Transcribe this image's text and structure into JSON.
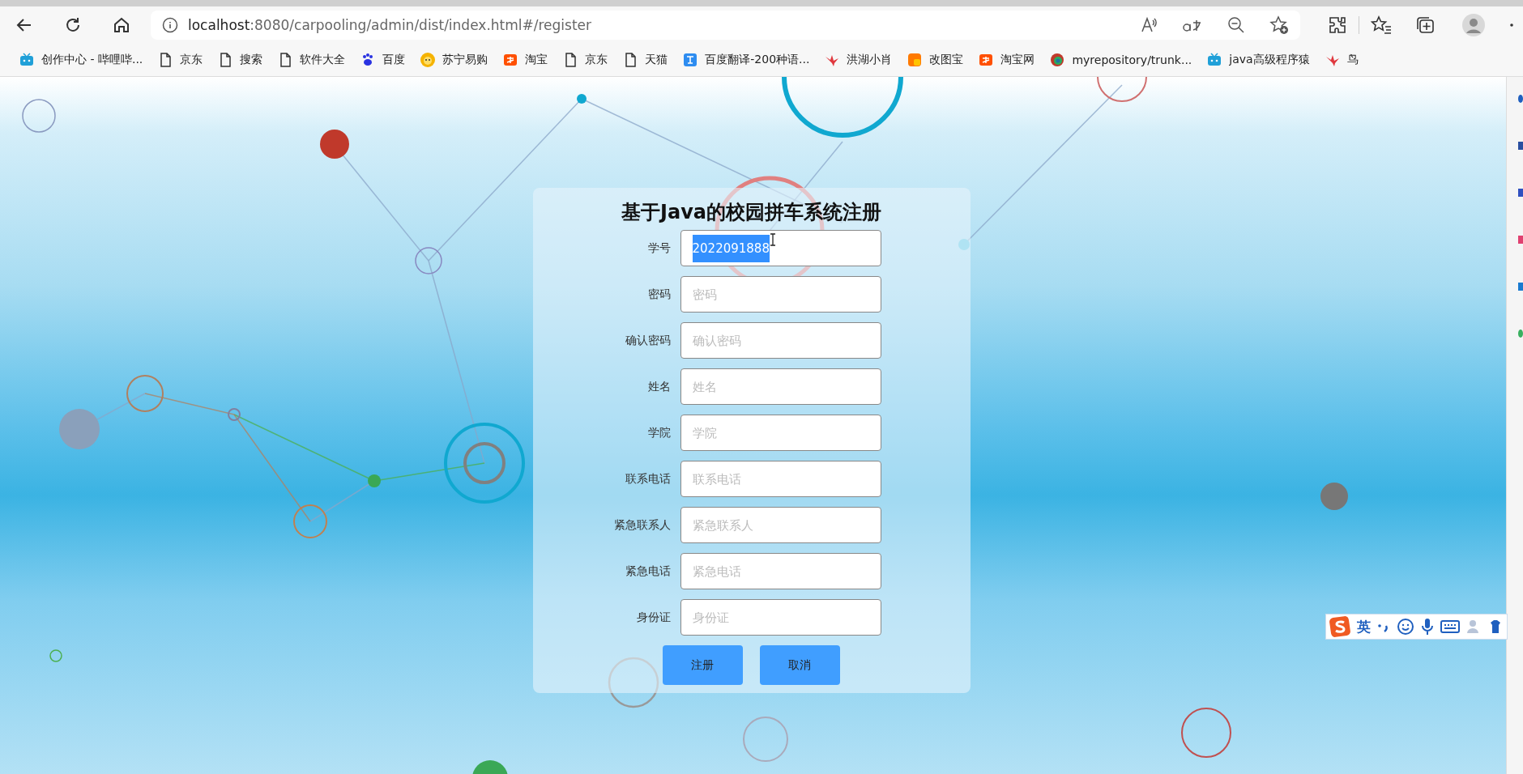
{
  "browser": {
    "url_host": "localhost",
    "url_rest": ":8080/carpooling/admin/dist/index.html#/register"
  },
  "bookmarks": [
    {
      "label": "创作中心 - 哔哩哔...",
      "kind": "tv"
    },
    {
      "label": "京东",
      "kind": "page"
    },
    {
      "label": "搜索",
      "kind": "page"
    },
    {
      "label": "软件大全",
      "kind": "page"
    },
    {
      "label": "百度",
      "kind": "paw"
    },
    {
      "label": "苏宁易购",
      "kind": "sun"
    },
    {
      "label": "淘宝",
      "kind": "tag"
    },
    {
      "label": "京东",
      "kind": "page"
    },
    {
      "label": "天猫",
      "kind": "page"
    },
    {
      "label": "百度翻译-200种语...",
      "kind": "translate"
    },
    {
      "label": "洪湖小肖",
      "kind": "bird"
    },
    {
      "label": "改图宝",
      "kind": "square"
    },
    {
      "label": "淘宝网",
      "kind": "tag"
    },
    {
      "label": "myrepository/trunk...",
      "kind": "ring"
    },
    {
      "label": "java高级程序猿",
      "kind": "tv"
    },
    {
      "label": "鸟",
      "kind": "bird"
    }
  ],
  "form": {
    "title": "基于Java的校园拼车系统注册",
    "fields": [
      {
        "label": "学号",
        "value": "2022091888",
        "text_selected": true
      },
      {
        "label": "密码",
        "placeholder": "密码"
      },
      {
        "label": "确认密码",
        "placeholder": "确认密码"
      },
      {
        "label": "姓名",
        "placeholder": "姓名"
      },
      {
        "label": "学院",
        "placeholder": "学院"
      },
      {
        "label": "联系电话",
        "placeholder": "联系电话"
      },
      {
        "label": "紧急联系人",
        "placeholder": "紧急联系人"
      },
      {
        "label": "紧急电话",
        "placeholder": "紧急电话"
      },
      {
        "label": "身份证",
        "placeholder": "身份证"
      }
    ],
    "buttons": [
      "注册",
      "取消"
    ]
  },
  "ime_toolbar": {
    "mode": "英"
  }
}
